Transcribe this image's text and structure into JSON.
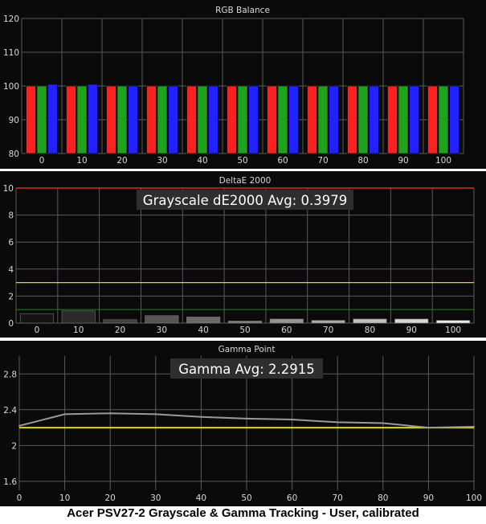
{
  "caption": "Acer PSV27-2 Grayscale & Gamma Tracking - User, calibrated",
  "colors": {
    "background": "#0a0a0a",
    "grid": "#5a5a5a",
    "text": "#d8d8d8",
    "red": "#ff2020",
    "green": "#1fa31f",
    "blue": "#2222ff",
    "yellow": "#e6d800",
    "dark_green": "#1c7a1c",
    "red_line": "#ff3030"
  },
  "chart_data": [
    {
      "type": "bar",
      "title": "RGB Balance",
      "categories": [
        "0",
        "10",
        "20",
        "30",
        "40",
        "50",
        "60",
        "70",
        "80",
        "90",
        "100"
      ],
      "series": [
        {
          "color": "red",
          "values": [
            100,
            100,
            100,
            100,
            100,
            100,
            100,
            100,
            100,
            100,
            100
          ]
        },
        {
          "color": "green",
          "values": [
            100,
            100,
            100,
            100,
            100,
            100,
            100,
            100,
            100,
            100,
            100
          ]
        },
        {
          "color": "blue",
          "values": [
            100.5,
            100.5,
            100,
            100,
            100,
            100,
            100,
            100,
            100,
            100,
            100
          ]
        }
      ],
      "ylim": [
        80,
        120
      ],
      "yticks": [
        "80",
        "90",
        "100",
        "110",
        "120"
      ],
      "grid": true
    },
    {
      "type": "bar",
      "title": "DeltaE 2000",
      "annotation": "Grayscale dE2000 Avg: 0.3979",
      "categories": [
        "0",
        "10",
        "20",
        "30",
        "40",
        "50",
        "60",
        "70",
        "80",
        "90",
        "100"
      ],
      "values": [
        0.7,
        0.9,
        0.25,
        0.55,
        0.45,
        0.15,
        0.3,
        0.2,
        0.3,
        0.3,
        0.2
      ],
      "ylim": [
        0,
        10
      ],
      "yticks": [
        "0",
        "2",
        "4",
        "6",
        "8",
        "10"
      ],
      "reference_lines": [
        {
          "value": 10,
          "color": "red_line"
        },
        {
          "value": 3,
          "color": "yellow"
        },
        {
          "value": 1,
          "color": "dark_green"
        }
      ],
      "grid": true
    },
    {
      "type": "line",
      "title": "Gamma Point",
      "annotation": "Gamma Avg: 2.2915",
      "x": [
        0,
        10,
        20,
        30,
        40,
        50,
        60,
        70,
        80,
        90,
        100
      ],
      "values": [
        2.22,
        2.35,
        2.36,
        2.35,
        2.32,
        2.3,
        2.29,
        2.26,
        2.25,
        2.2,
        2.21
      ],
      "target": 2.2,
      "xlim": [
        0,
        100
      ],
      "ylim": [
        1.5,
        3.0
      ],
      "xticks": [
        "0",
        "10",
        "20",
        "30",
        "40",
        "50",
        "60",
        "70",
        "80",
        "90",
        "100"
      ],
      "yticks": [
        "1.6",
        "2",
        "2.4",
        "2.8"
      ],
      "grid": true
    }
  ]
}
